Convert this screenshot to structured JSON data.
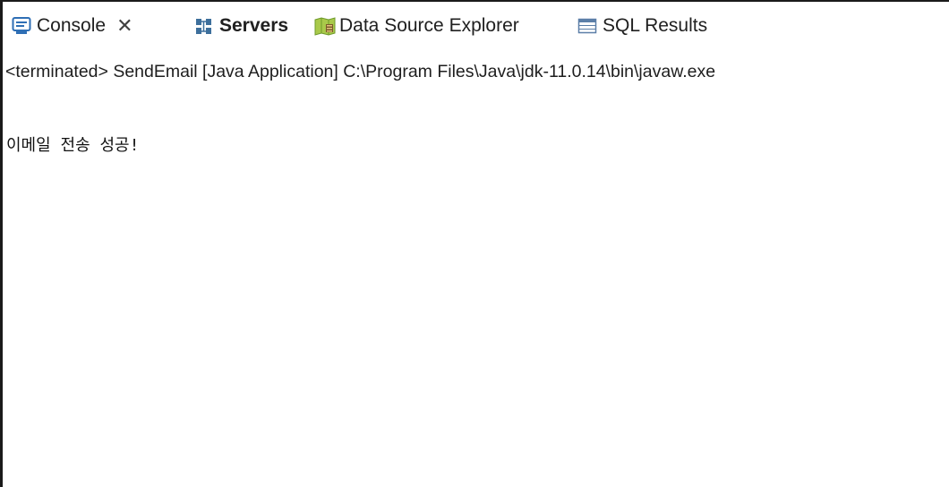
{
  "tabs": [
    {
      "label": "Console",
      "icon": "console-icon",
      "active": true,
      "closable": true
    },
    {
      "label": "Servers",
      "icon": "servers-icon",
      "active": false,
      "bold": true
    },
    {
      "label": "Data Source Explorer",
      "icon": "data-source-explorer-icon",
      "active": false
    },
    {
      "label": "SQL Results",
      "icon": "sql-results-icon",
      "active": false
    }
  ],
  "close_glyph": "✕",
  "console": {
    "status": "<terminated> SendEmail [Java Application] C:\\Program Files\\Java\\jdk-11.0.14\\bin\\javaw.exe",
    "output_lines": [
      "이메일 전송 성공!"
    ]
  },
  "colors": {
    "console_icon": "#2f6fb5",
    "servers_icon": "#3d6f9c",
    "data_source_icon": "#6e9a2a",
    "sql_icon": "#5c7fa8"
  }
}
